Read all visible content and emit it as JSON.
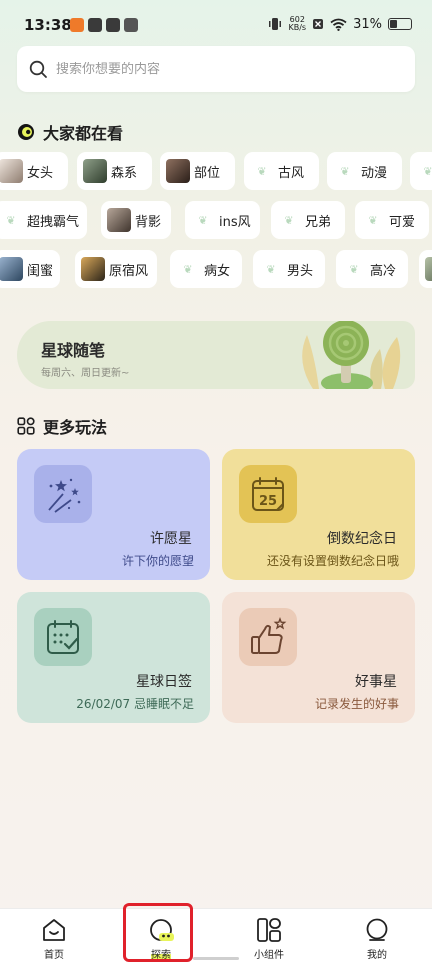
{
  "status_bar": {
    "time": "13:38",
    "net_speed_value": "602",
    "net_speed_unit": "KB/s",
    "battery": "31%",
    "battery_level": 0.31
  },
  "search": {
    "placeholder": "搜索你想要的内容",
    "value": ""
  },
  "trending": {
    "title": "大家都在看",
    "rows": [
      [
        {
          "label": "女头",
          "thumb": "#c8b7ad"
        },
        {
          "label": "森系",
          "thumb": "#56684f"
        },
        {
          "label": "部位",
          "thumb": "#4d3c33"
        },
        {
          "label": "古风",
          "thumb": ""
        },
        {
          "label": "动漫",
          "thumb": ""
        },
        {
          "label": "",
          "thumb": ""
        }
      ],
      [
        {
          "label": "超拽霸气",
          "thumb": ""
        },
        {
          "label": "背影",
          "thumb": "#5b4e45"
        },
        {
          "label": "ins风",
          "thumb": ""
        },
        {
          "label": "兄弟",
          "thumb": ""
        },
        {
          "label": "可爱",
          "thumb": ""
        }
      ],
      [
        {
          "label": "闺蜜",
          "thumb": "#3a5b7c"
        },
        {
          "label": "原宿风",
          "thumb": "#3f3325"
        },
        {
          "label": "病女",
          "thumb": ""
        },
        {
          "label": "男头",
          "thumb": ""
        },
        {
          "label": "高冷",
          "thumb": ""
        },
        {
          "label": "",
          "thumb": "#8a9a80"
        }
      ]
    ]
  },
  "banner": {
    "title": "星球随笔",
    "subtitle": "每周六、周日更新~"
  },
  "more": {
    "title": "更多玩法",
    "cards": [
      {
        "title": "许愿星",
        "subtitle": "许下你的愿望",
        "bg": "#c5cbf6",
        "icon_bg": "#a9b1ea",
        "sub_color": "#3e4a8a",
        "icon": "fireworks-icon"
      },
      {
        "title": "倒数纪念日",
        "subtitle": "还没有设置倒数纪念日哦",
        "bg": "#f1df9a",
        "icon_bg": "#e3c355",
        "sub_color": "#7a6520",
        "icon": "calendar-25-icon",
        "day": "25"
      },
      {
        "title": "星球日签",
        "subtitle": "26/02/07 忌睡眠不足",
        "bg": "#cfe4da",
        "icon_bg": "#a9d0bf",
        "sub_color": "#3e6a57",
        "icon": "calendar-check-icon"
      },
      {
        "title": "好事星",
        "subtitle": "记录发生的好事",
        "bg": "#f4e2d7",
        "icon_bg": "#ebcbb7",
        "sub_color": "#8a5a3e",
        "icon": "thumbs-up-icon"
      }
    ]
  },
  "bottom_nav": {
    "items": [
      {
        "label": "首页",
        "icon": "home-icon"
      },
      {
        "label": "探索",
        "icon": "explore-icon"
      },
      {
        "label": "小组件",
        "icon": "widgets-icon"
      },
      {
        "label": "我的",
        "icon": "profile-icon"
      }
    ],
    "active_index": 1
  }
}
